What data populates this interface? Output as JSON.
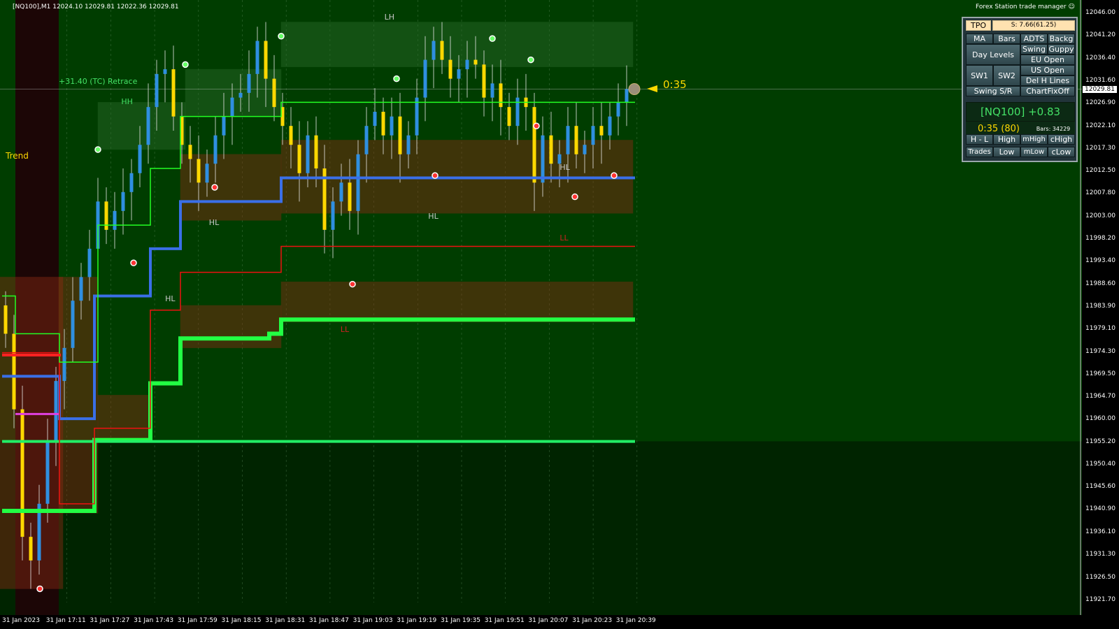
{
  "header": {
    "ohlc": "[NQ100],M1  12024.10 12029.81 12022.36 12029.81",
    "panel_title": "Forex Station trade manager ☺"
  },
  "annotations": {
    "retrace": "+31.40 (TC) Retrace",
    "trend": "Trend",
    "countdown": "0:35"
  },
  "swing_labels": [
    {
      "text": "LH",
      "x": "31 Jan 19:03",
      "y": 12045.0,
      "color": "#c8c8c8"
    },
    {
      "text": "HH",
      "x": "31 Jan 17:27",
      "y": 12027.1,
      "color": "#44e266"
    },
    {
      "text": "HL",
      "x": "31 Jan 17:59",
      "y": 12001.5,
      "color": "#c8c8c8"
    },
    {
      "text": "HL",
      "x": "31 Jan 17:43",
      "y": 11985.4,
      "color": "#c8c8c8"
    },
    {
      "text": "HL",
      "x": "31 Jan 19:19",
      "y": 12002.8,
      "color": "#c8c8c8"
    },
    {
      "text": "HL",
      "x": "31 Jan 20:07",
      "y": 12013.1,
      "color": "#c8c8c8"
    },
    {
      "text": "LL",
      "x": "31 Jan 20:07",
      "y": 11998.2,
      "color": "#cc2222"
    },
    {
      "text": "LL",
      "x": "31 Jan 18:47",
      "y": 11978.8,
      "color": "#cc2222"
    }
  ],
  "price_axis": {
    "labels": [
      "12046.00",
      "12041.20",
      "12036.40",
      "12031.60",
      "12026.90",
      "12022.10",
      "12017.30",
      "12012.50",
      "12007.80",
      "12003.00",
      "11998.20",
      "11993.40",
      "11988.60",
      "11983.90",
      "11979.10",
      "11974.30",
      "11969.50",
      "11964.70",
      "11960.00",
      "11955.20",
      "11950.40",
      "11945.60",
      "11940.90",
      "11936.10",
      "11931.30",
      "11926.50",
      "11921.70"
    ],
    "current": "12029.81"
  },
  "time_axis": {
    "labels": [
      "31 Jan 2023",
      "31 Jan 17:11",
      "31 Jan 17:27",
      "31 Jan 17:43",
      "31 Jan 17:59",
      "31 Jan 18:15",
      "31 Jan 18:31",
      "31 Jan 18:47",
      "31 Jan 19:03",
      "31 Jan 19:19",
      "31 Jan 19:35",
      "31 Jan 19:51",
      "31 Jan 20:07",
      "31 Jan 20:23",
      "31 Jan 20:39"
    ]
  },
  "panel": {
    "tpo": "TPO",
    "s_info": "S: 7.66(61.25)",
    "ma": "MA",
    "bars": "Bars",
    "adts": "ADTS",
    "backg": "Backg",
    "day_levels": "Day Levels",
    "swing": "Swing",
    "guppy": "Guppy",
    "eu_open": "EU Open",
    "us_open": "US Open",
    "sw1": "SW1",
    "sw2": "SW2",
    "del_h_lines": "Del H Lines",
    "swing_sr": "Swing S/R",
    "chart_fix_off": "ChartFixOff",
    "symbol_change": "[NQ100] +0.83",
    "timer": "0:35 (80)",
    "bars_count": "Bars: 34229",
    "h_l": "H - L",
    "high": "High",
    "mhigh": "mHigh",
    "chigh": "cHigh",
    "trades": "Trades",
    "low": "Low",
    "mlow": "mLow",
    "clow": "cLow"
  },
  "colors": {
    "bg_top": "#003d00",
    "bg_bottom": "#002400",
    "bull": "#2f8fe0",
    "bear": "#ffd800",
    "support": "#22ff44",
    "resistance": "#ee1111",
    "mid": "#3a6fe8",
    "zone_red": "#8a2a14",
    "zone_green": "#2a6a2a"
  },
  "chart_data": {
    "type": "candlestick",
    "symbol": "NQ100",
    "timeframe": "M1",
    "ylim": [
      11921.7,
      12046.0
    ],
    "x_ticks": [
      "31 Jan 2023",
      "31 Jan 17:11",
      "31 Jan 17:27",
      "31 Jan 17:43",
      "31 Jan 17:59",
      "31 Jan 18:15",
      "31 Jan 18:31",
      "31 Jan 18:47",
      "31 Jan 19:03",
      "31 Jan 19:19",
      "31 Jan 19:35",
      "31 Jan 19:51",
      "31 Jan 20:07",
      "31 Jan 20:23",
      "31 Jan 20:39"
    ],
    "last": 12029.81,
    "open": 12024.1,
    "high": 12029.81,
    "low": 12022.36,
    "close_series": [
      11978,
      11962,
      11935,
      11930,
      11942,
      11955,
      11968,
      11975,
      11985,
      11990,
      11996,
      12006,
      12000,
      12004,
      12008,
      12012,
      12018,
      12026,
      12033,
      12034,
      12024,
      12018,
      12015,
      12010,
      12014,
      12020,
      12024,
      12028,
      12029,
      12033,
      12040,
      12032,
      12026,
      12022,
      12018,
      12012,
      12020,
      12013,
      12000,
      12006,
      12010,
      12004,
      12016,
      12022,
      12025,
      12020,
      12024,
      12016,
      12020,
      12028,
      12036,
      12040,
      12036,
      12032,
      12034,
      12036,
      12035,
      12028,
      12031,
      12026,
      12022,
      12028,
      12026,
      12010,
      12020,
      12014,
      12016,
      12022,
      12016,
      12018,
      12022,
      12020,
      12024,
      12027,
      12029.81
    ]
  }
}
